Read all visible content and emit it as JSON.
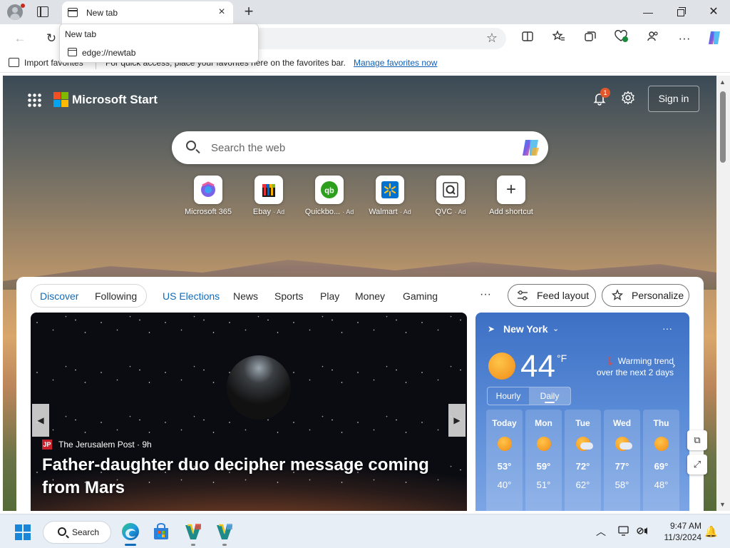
{
  "browser": {
    "tab": {
      "title": "New tab",
      "close": "×"
    },
    "new_tab": "+",
    "window": {
      "minimize": "—",
      "close": "✕"
    },
    "tooltip": {
      "title": "New tab",
      "url": "edge://newtab"
    },
    "toolbar": {
      "back": "←",
      "refresh": "↻",
      "favorite_star": "☆"
    },
    "favorites_bar": {
      "import_label": "Import favorites",
      "message": "For quick access, place your favorites here on the favorites bar.",
      "manage_link": "Manage favorites now"
    }
  },
  "page": {
    "brand": "Microsoft Start",
    "notifications_count": "1",
    "sign_in": "Sign in",
    "search_placeholder": "Search the web",
    "shortcuts": [
      {
        "label": "Microsoft 365",
        "ad": ""
      },
      {
        "label": "Ebay",
        "ad": "· Ad"
      },
      {
        "label": "Quickbo...",
        "ad": "· Ad"
      },
      {
        "label": "Walmart",
        "ad": "· Ad"
      },
      {
        "label": "QVC",
        "ad": "· Ad"
      },
      {
        "label": "Add shortcut",
        "ad": ""
      }
    ],
    "nav": {
      "discover": "Discover",
      "following": "Following",
      "items": [
        "US Elections",
        "News",
        "Sports",
        "Play",
        "Money",
        "Gaming"
      ],
      "more": "···",
      "feed_layout": "Feed layout",
      "personalize": "Personalize"
    },
    "hero": {
      "source": "The Jerusalem Post · 9h",
      "source_logo": "JP",
      "headline": "Father-daughter duo decipher message coming from Mars"
    },
    "weather": {
      "location": "New York",
      "temp": "44",
      "unit": "°F",
      "trend_title": "Warming trend",
      "trend_sub": "over the next 2 days",
      "hourly": "Hourly",
      "daily": "Daily",
      "more": "···",
      "days": [
        {
          "name": "Today",
          "hi": "53°",
          "lo": "40°",
          "icon": "sunny-icon"
        },
        {
          "name": "Mon",
          "hi": "59°",
          "lo": "51°",
          "icon": "sunny-icon"
        },
        {
          "name": "Tue",
          "hi": "72°",
          "lo": "62°",
          "icon": "partly-cloudy-icon"
        },
        {
          "name": "Wed",
          "hi": "77°",
          "lo": "58°",
          "icon": "partly-cloudy-icon"
        },
        {
          "name": "Thu",
          "hi": "69°",
          "lo": "48°",
          "icon": "sunny-icon"
        }
      ]
    }
  },
  "taskbar": {
    "search_label": "Search",
    "time": "9:47 AM",
    "date": "11/3/2024"
  },
  "colors": {
    "accent": "#0f6cbd",
    "weather_bg": "#3d6fc4"
  }
}
